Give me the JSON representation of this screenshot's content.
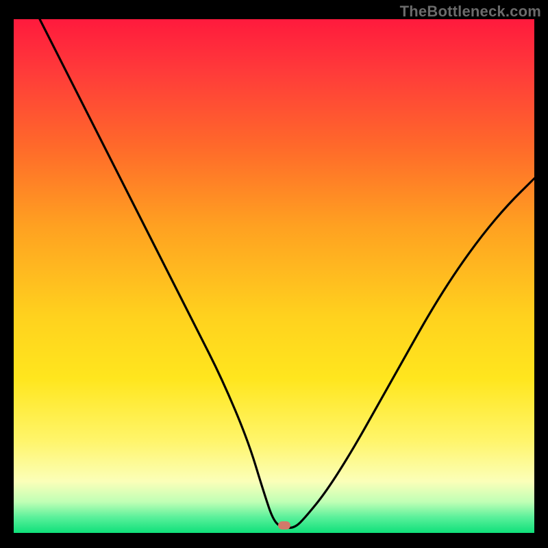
{
  "watermark": "TheBottleneck.com",
  "chart_data": {
    "type": "line",
    "title": "",
    "xlabel": "",
    "ylabel": "",
    "xlim": [
      0,
      100
    ],
    "ylim": [
      0,
      100
    ],
    "grid": false,
    "legend": false,
    "marker": {
      "x": 52,
      "y": 1.5
    },
    "series": [
      {
        "name": "bottleneck-curve",
        "x": [
          5,
          10,
          15,
          20,
          25,
          30,
          35,
          40,
          45,
          48,
          50,
          52,
          54,
          56,
          60,
          65,
          70,
          75,
          80,
          85,
          90,
          95,
          100
        ],
        "y": [
          100,
          90,
          80,
          70,
          60,
          50,
          40,
          30,
          18,
          8,
          2,
          1,
          1,
          3,
          8,
          16,
          25,
          34,
          43,
          51,
          58,
          64,
          69
        ]
      }
    ],
    "background_gradient": {
      "orientation": "vertical",
      "stops": [
        {
          "pos": 0.0,
          "color": "#ff1a3d"
        },
        {
          "pos": 0.25,
          "color": "#ff6a2a"
        },
        {
          "pos": 0.55,
          "color": "#ffd21e"
        },
        {
          "pos": 0.82,
          "color": "#fff56a"
        },
        {
          "pos": 0.94,
          "color": "#bfffb5"
        },
        {
          "pos": 1.0,
          "color": "#0fe07a"
        }
      ]
    }
  }
}
